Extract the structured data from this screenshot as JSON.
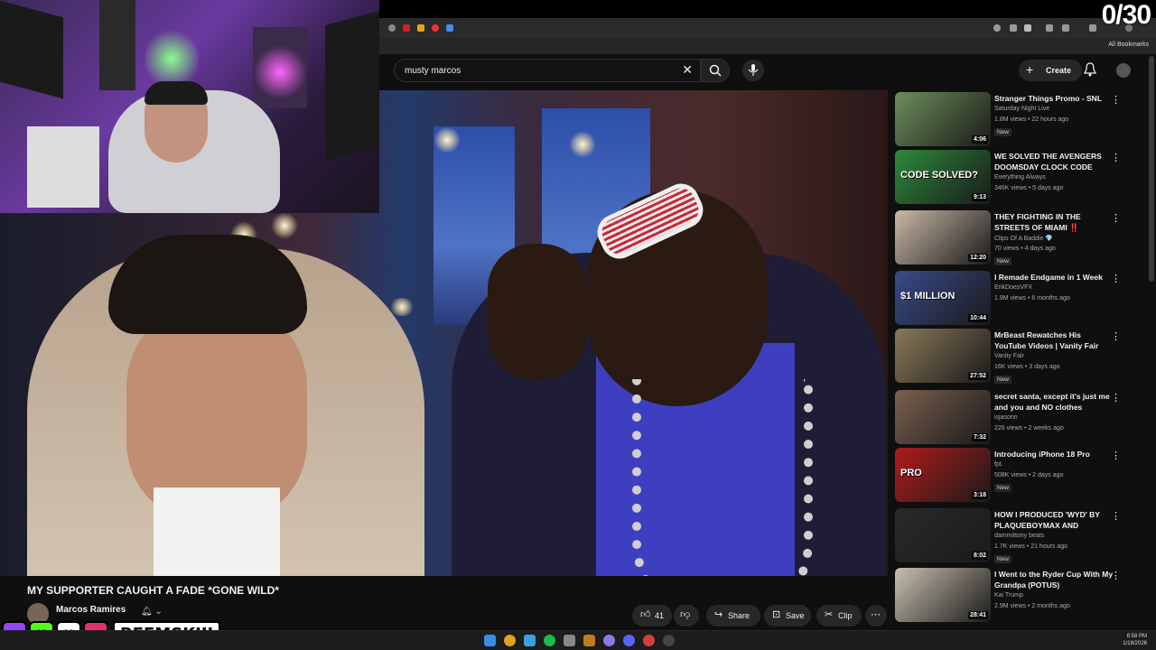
{
  "overlay": {
    "counter": "0/30",
    "social_handle": "BEEMSKIII"
  },
  "browser": {
    "bookmarks_label": "All Bookmarks"
  },
  "search": {
    "query": "musty marcos"
  },
  "header": {
    "create_label": "Create"
  },
  "video": {
    "title": "MY SUPPORTER CAUGHT A FADE *GONE WILD*",
    "channel": "Marcos Ramires",
    "likes": "41",
    "share_label": "Share",
    "save_label": "Save",
    "clip_label": "Clip"
  },
  "recommendations": [
    {
      "title": "Stranger Things Promo - SNL",
      "channel": "Saturday Night Live",
      "meta": "1.8M views • 22 hours ago",
      "badge": "New",
      "duration": "4:06",
      "thumb_color": "#6d8f5a"
    },
    {
      "title": "WE SOLVED THE AVENGERS DOOMSDAY CLOCK CODE",
      "channel": "Everything Always",
      "meta": "346K views • 5 days ago",
      "badge": "",
      "duration": "9:13",
      "thumb_color": "#2d8a3a",
      "thumb_text": "CODE SOLVED?"
    },
    {
      "title": "THEY FIGHTING IN THE STREETS OF MIAMI ‼️",
      "channel": "Clips Of A Baddie 💎",
      "meta": "70 views • 4 days ago",
      "badge": "New",
      "duration": "12:20",
      "thumb_color": "#c9b8a6"
    },
    {
      "title": "I Remade Endgame in 1 Week",
      "channel": "ErikDoesVFX",
      "meta": "1.9M views • 6 months ago",
      "badge": "",
      "duration": "10:44",
      "thumb_color": "#3a4a8a",
      "thumb_text": "$1 MILLION"
    },
    {
      "title": "MrBeast Rewatches His YouTube Videos | Vanity Fair",
      "channel": "Vanity Fair",
      "meta": "16K views • 3 days ago",
      "badge": "New",
      "duration": "27:52",
      "thumb_color": "#8a7a5a"
    },
    {
      "title": "secret santa, except it's just me and you and NO clothes during...",
      "channel": "isjasonn",
      "meta": "226 views • 2 weeks ago",
      "badge": "",
      "duration": "7:32",
      "thumb_color": "#7a6050"
    },
    {
      "title": "Introducing iPhone 18 Pro",
      "channel": "fpt.",
      "meta": "508K views • 2 days ago",
      "badge": "New",
      "duration": "3:18",
      "thumb_color": "#b01a1a",
      "thumb_text": "PRO"
    },
    {
      "title": "HOW I PRODUCED 'WYD' BY PLAQUEBOYMAX AND BRYSO...",
      "channel": "dammittony beats",
      "meta": "1.7K views • 21 hours ago",
      "badge": "New",
      "duration": "8:02",
      "thumb_color": "#2a2a2a"
    },
    {
      "title": "I Went to the Ryder Cup With My Grandpa (POTUS)",
      "channel": "Kai Trump",
      "meta": "2.9M views • 2 months ago",
      "badge": "",
      "duration": "28:41",
      "thumb_color": "#c8c0b0"
    }
  ],
  "taskbar": {
    "time": "8:58 PM",
    "date": "1/18/2026"
  },
  "colors": {
    "background": "#0f0f0f",
    "accent_red": "#ff0000"
  }
}
